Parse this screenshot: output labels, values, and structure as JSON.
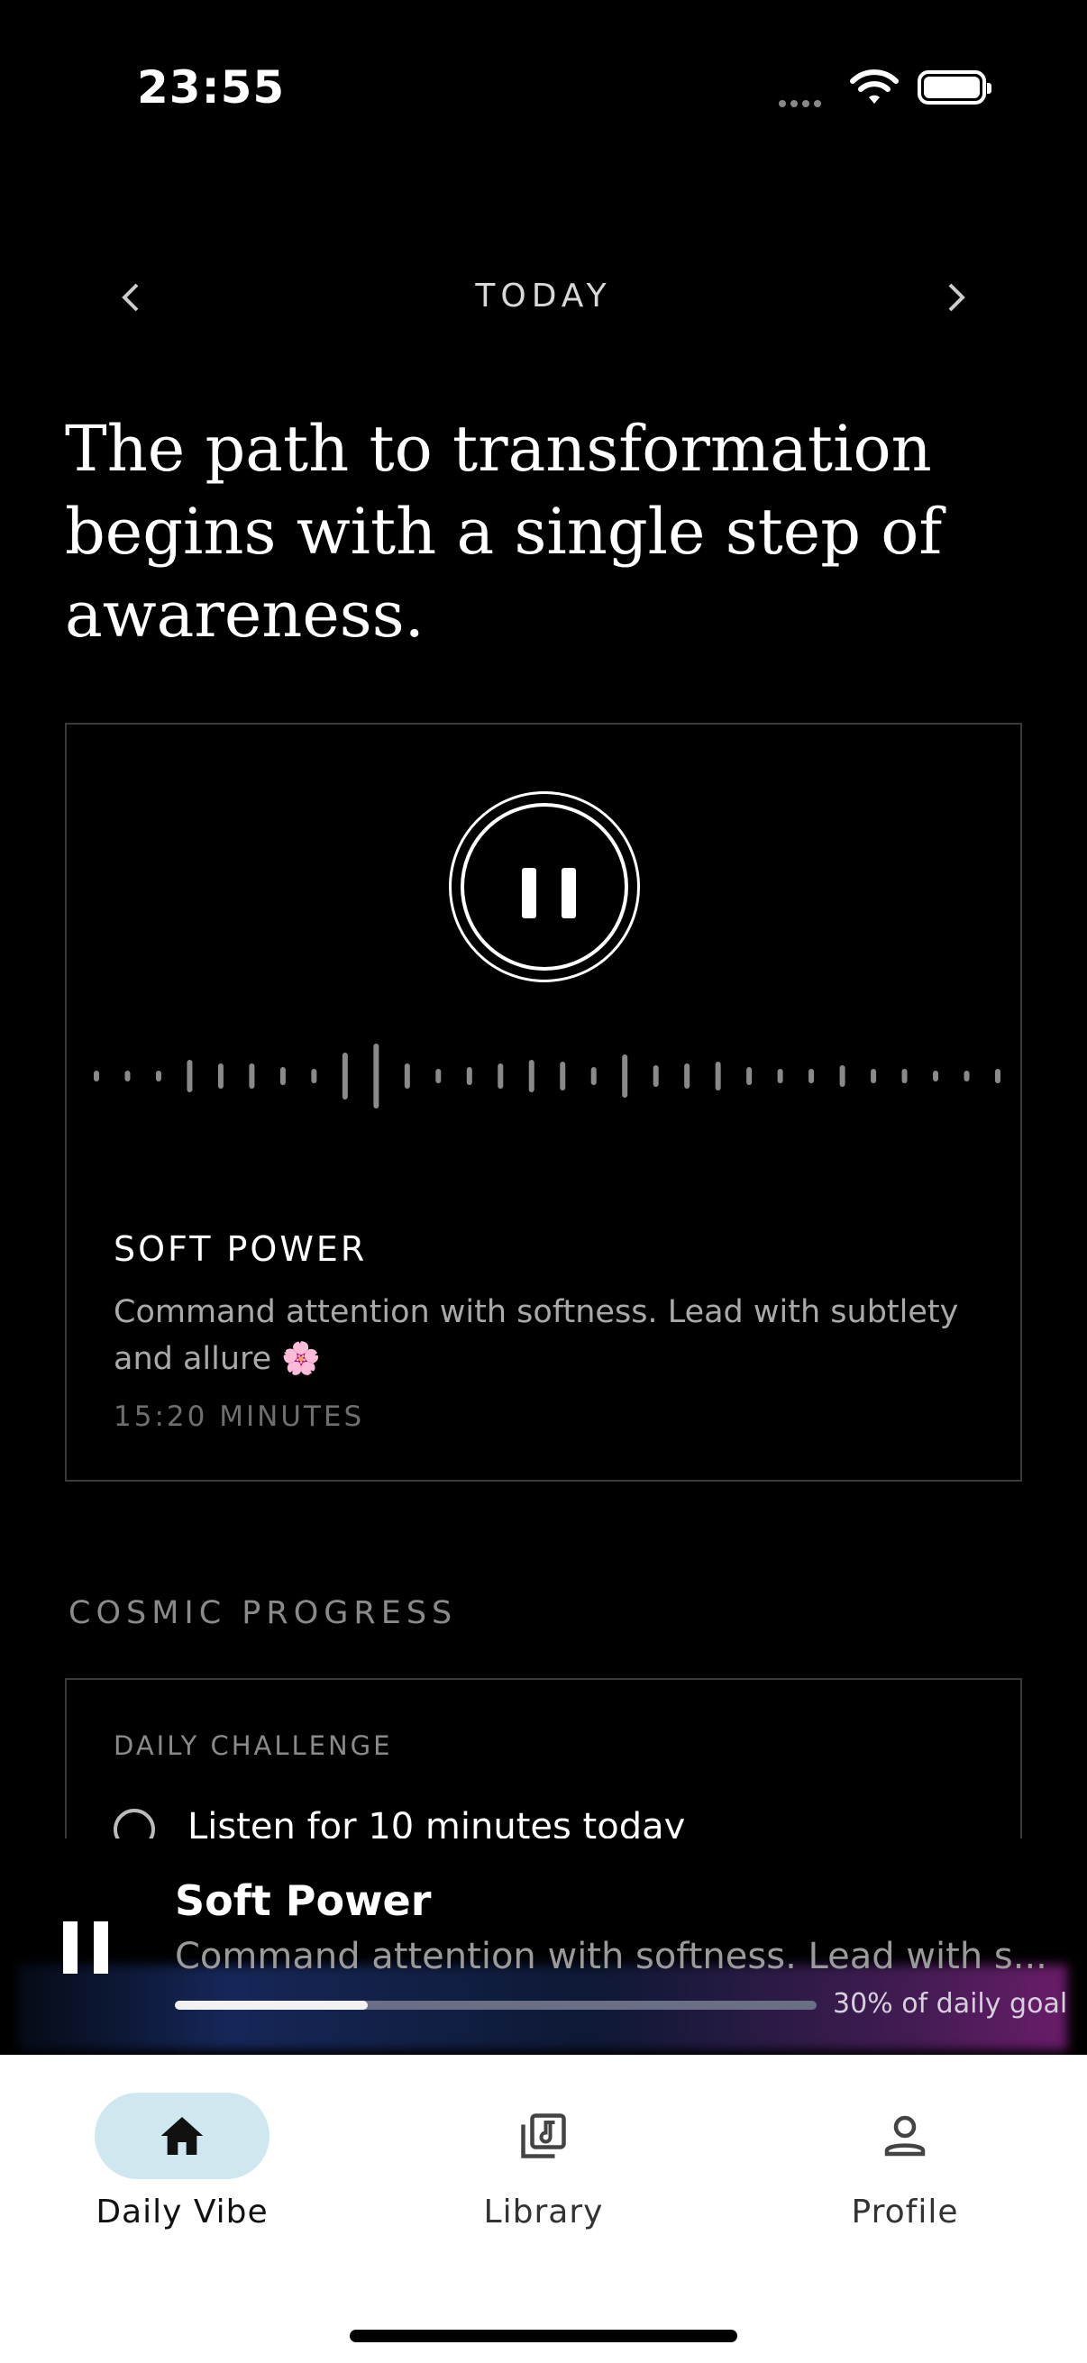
{
  "status": {
    "time": "23:55"
  },
  "nav": {
    "day": "TODAY"
  },
  "quote": "The path to transformation begins with a single step of awareness.",
  "session": {
    "title": "SOFT POWER",
    "description": "Command attention with softness. Lead with subtlety and allure 🌸",
    "duration": "15:20 MINUTES"
  },
  "cosmic": {
    "section_title": "COSMIC PROGRESS",
    "challenge_label": "DAILY CHALLENGE",
    "challenge_text": "Listen for 10 minutes today"
  },
  "mini_player": {
    "title": "Soft Power",
    "subtitle": "Command attention with softness. Lead with s...",
    "progress": 0.3,
    "goal_text": "30% of daily goal"
  },
  "tabs": [
    {
      "label": "Daily Vibe",
      "icon": "home-icon",
      "active": true
    },
    {
      "label": "Library",
      "icon": "music-library-icon",
      "active": false
    },
    {
      "label": "Profile",
      "icon": "person-icon",
      "active": false
    }
  ],
  "colors": {
    "accent_tab": "#cfe8ef",
    "background": "#000000"
  }
}
